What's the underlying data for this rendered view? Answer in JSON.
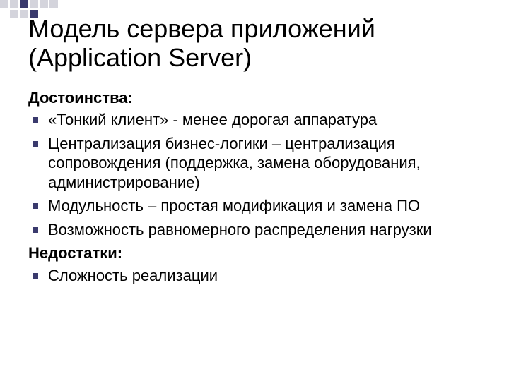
{
  "title": "Модель сервера приложений (Application Server)",
  "advantages_heading": "Достоинства:",
  "advantages": [
    "«Тонкий клиент» - менее дорогая аппаратура",
    "Централизация бизнес-логики – централизация сопровождения (поддержка, замена оборудования, администрирование)",
    "Модульность – простая модификация и замена ПО",
    "Возможность равномерного распределения нагрузки"
  ],
  "disadvantages_heading": "Недостатки:",
  "disadvantages": [
    "Сложность реализации"
  ]
}
